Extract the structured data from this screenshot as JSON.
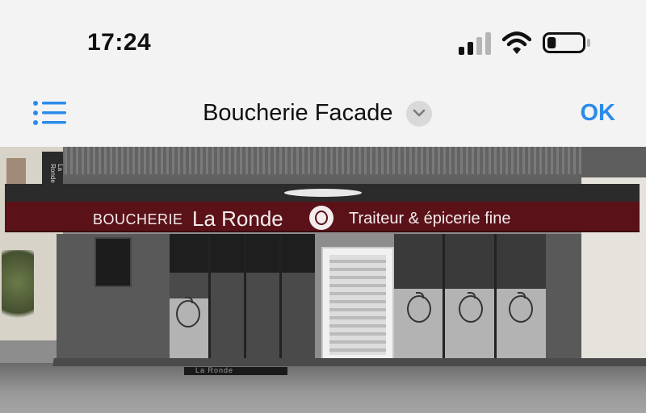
{
  "status": {
    "time": "17:24",
    "signal_icon": "cellular-signal-icon",
    "wifi_icon": "wifi-icon",
    "battery_icon": "battery-icon",
    "battery_level_fraction": 0.25
  },
  "nav": {
    "menu_icon": "list-icon",
    "title": "Boucherie Facade",
    "chevron_icon": "chevron-down-icon",
    "ok_label": "OK",
    "accent_color": "#2b8bea"
  },
  "storefront": {
    "awning_word": "BOUCHERIE",
    "awning_name": "La Ronde",
    "awning_tagline": "Traiteur & épicerie fine",
    "awning_color": "#5a1218",
    "doormat_text": "La Ronde",
    "side_sign_text": "La Ronde"
  }
}
